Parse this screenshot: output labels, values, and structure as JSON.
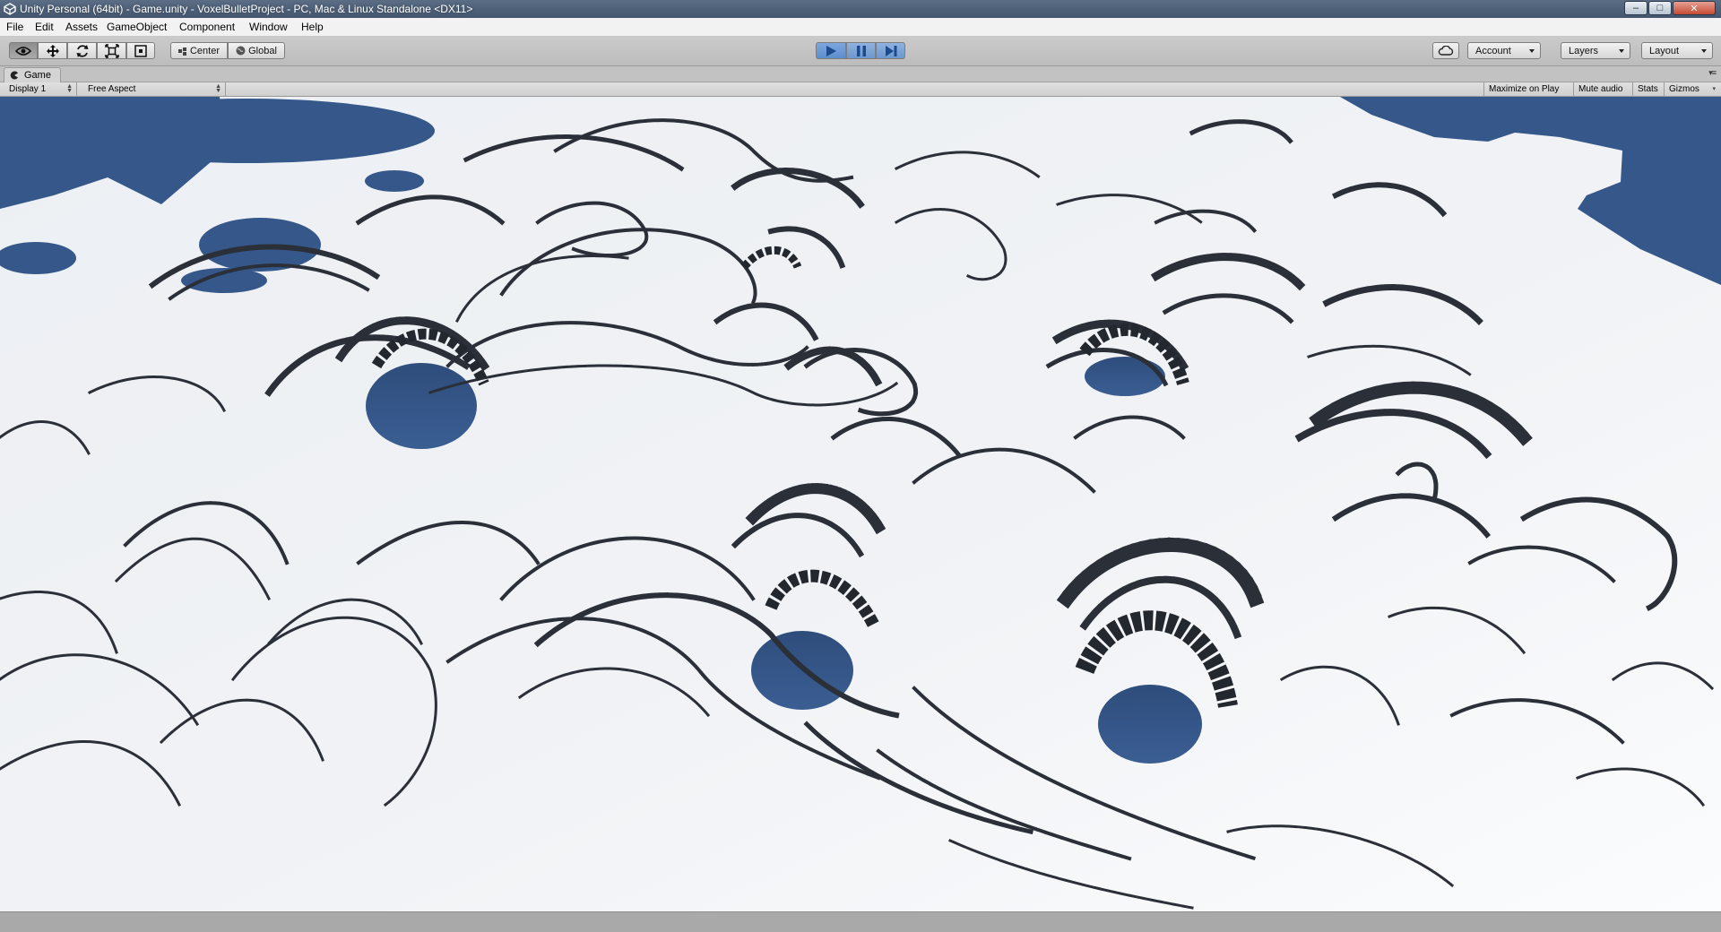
{
  "window": {
    "title": "Unity Personal (64bit) - Game.unity - VoxelBulletProject - PC, Mac & Linux Standalone <DX11>",
    "minimize_symbol": "‒",
    "maximize_symbol": "□",
    "close_symbol": "✕"
  },
  "menu": {
    "items": [
      "File",
      "Edit",
      "Assets",
      "GameObject",
      "Component",
      "Window",
      "Help"
    ]
  },
  "toolbar": {
    "tools": [
      {
        "name": "view-tool",
        "icon": "eye-icon",
        "active": true
      },
      {
        "name": "move-tool",
        "icon": "move-arrows-icon",
        "active": false
      },
      {
        "name": "rotate-tool",
        "icon": "rotate-icon",
        "active": false
      },
      {
        "name": "scale-tool",
        "icon": "scale-icon",
        "active": false
      },
      {
        "name": "rect-tool",
        "icon": "rect-icon",
        "active": false
      }
    ],
    "pivot_label": "Center",
    "space_label": "Global",
    "playback": {
      "play_active": true,
      "pause_active": false
    },
    "account_label": "Account",
    "layers_label": "Layers",
    "layout_label": "Layout"
  },
  "game_view": {
    "tab_label": "Game",
    "display_label": "Display 1",
    "aspect_label": "Free Aspect",
    "maximize_on_play": "Maximize on Play",
    "mute_audio": "Mute audio",
    "stats": "Stats",
    "gizmos": "Gizmos"
  },
  "colors": {
    "sky_blue": "#35578a",
    "terrain_white": "#f2f3f6",
    "shadow_dark": "#262b33",
    "play_blue": "#6d97cf"
  }
}
